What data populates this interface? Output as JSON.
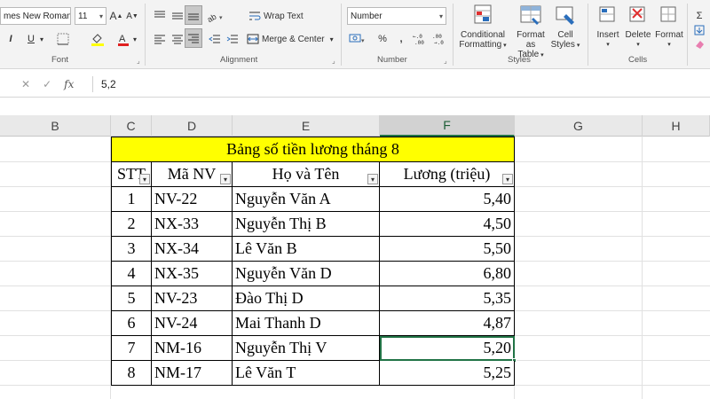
{
  "ribbon": {
    "font": {
      "name": "mes New Roman",
      "size": "11",
      "group_label": "Font"
    },
    "alignment": {
      "wrap_text": "Wrap Text",
      "merge_center": "Merge & Center",
      "group_label": "Alignment"
    },
    "number": {
      "format": "Number",
      "group_label": "Number"
    },
    "styles": {
      "conditional_formatting": [
        "Conditional",
        "Formatting"
      ],
      "format_as_table": [
        "Format as",
        "Table"
      ],
      "cell_styles": [
        "Cell",
        "Styles"
      ],
      "group_label": "Styles"
    },
    "cells": {
      "insert": "Insert",
      "delete": "Delete",
      "format": "Format",
      "group_label": "Cells"
    }
  },
  "formula_bar": {
    "fx": "fx",
    "value": "5,2"
  },
  "columns": [
    "B",
    "C",
    "D",
    "E",
    "F",
    "G",
    "H"
  ],
  "selected_column": "F",
  "table": {
    "title": "Bảng số tiền lương tháng 8",
    "headers": [
      "STT",
      "Mã NV",
      "Họ và Tên",
      "Lương (triệu)"
    ],
    "rows": [
      {
        "stt": "1",
        "ma": "NV-22",
        "ten": "Nguyễn Văn A",
        "luong": "5,40"
      },
      {
        "stt": "2",
        "ma": "NX-33",
        "ten": "Nguyễn Thị B",
        "luong": "4,50"
      },
      {
        "stt": "3",
        "ma": "NX-34",
        "ten": "Lê Văn B",
        "luong": "5,50"
      },
      {
        "stt": "4",
        "ma": "NX-35",
        "ten": "Nguyễn Văn D",
        "luong": "6,80"
      },
      {
        "stt": "5",
        "ma": "NV-23",
        "ten": "Đào Thị D",
        "luong": "5,35"
      },
      {
        "stt": "6",
        "ma": "NV-24",
        "ten": "Mai Thanh D",
        "luong": "4,87"
      },
      {
        "stt": "7",
        "ma": "NM-16",
        "ten": "Nguyễn Thị V",
        "luong": "5,20"
      },
      {
        "stt": "8",
        "ma": "NM-17",
        "ten": "Lê Văn T",
        "luong": "5,25"
      }
    ]
  },
  "colors": {
    "accent": "#217346",
    "title_fill": "#ffff00"
  }
}
